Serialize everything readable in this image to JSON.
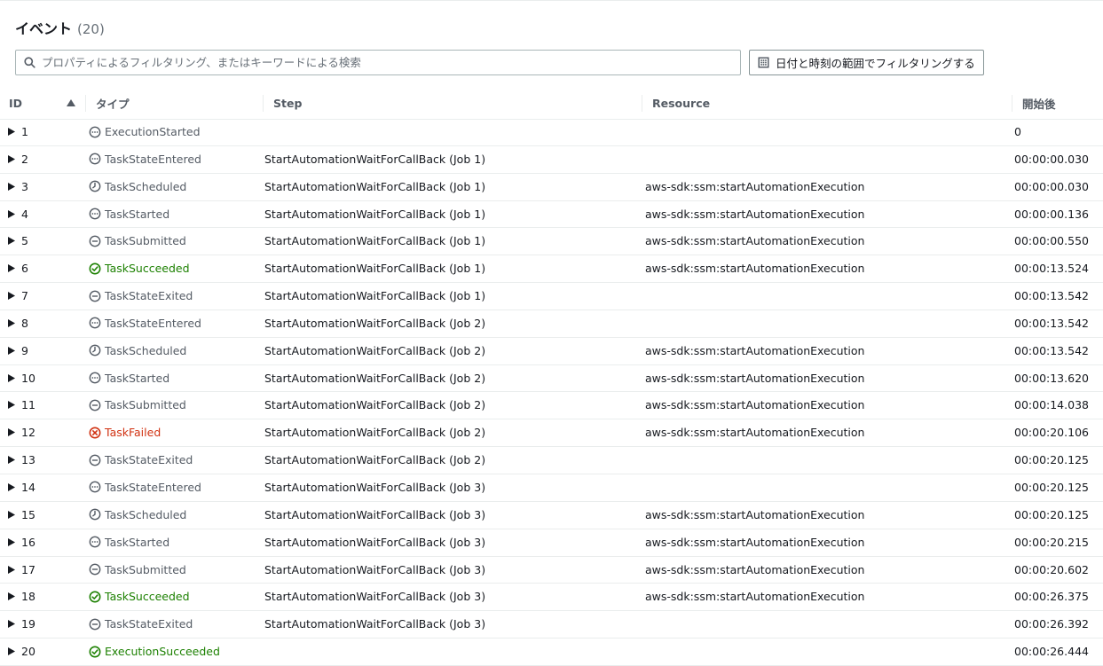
{
  "header": {
    "title": "イベント",
    "count": "(20)"
  },
  "search": {
    "placeholder": "プロパティによるフィルタリング、またはキーワードによる検索"
  },
  "date_filter": {
    "label": "日付と時刻の範囲でフィルタリングする"
  },
  "columns": {
    "id": "ID",
    "type": "タイプ",
    "step": "Step",
    "resource": "Resource",
    "elapsed": "開始後"
  },
  "colors": {
    "success": "#1d8102",
    "error": "#d13212",
    "neutral": "#545b64"
  },
  "rows": [
    {
      "id": "1",
      "type": "ExecutionStarted",
      "icon": "dots-circle-icon",
      "status": "neutral",
      "step": "",
      "resource": "",
      "elapsed": "0"
    },
    {
      "id": "2",
      "type": "TaskStateEntered",
      "icon": "dots-circle-icon",
      "status": "neutral",
      "step": "StartAutomationWaitForCallBack (Job 1)",
      "resource": "",
      "elapsed": "00:00:00.030"
    },
    {
      "id": "3",
      "type": "TaskScheduled",
      "icon": "clock-icon",
      "status": "neutral",
      "step": "StartAutomationWaitForCallBack (Job 1)",
      "resource": "aws-sdk:ssm:startAutomationExecution",
      "elapsed": "00:00:00.030"
    },
    {
      "id": "4",
      "type": "TaskStarted",
      "icon": "dots-circle-icon",
      "status": "neutral",
      "step": "StartAutomationWaitForCallBack (Job 1)",
      "resource": "aws-sdk:ssm:startAutomationExecution",
      "elapsed": "00:00:00.136"
    },
    {
      "id": "5",
      "type": "TaskSubmitted",
      "icon": "minus-circle-icon",
      "status": "neutral",
      "step": "StartAutomationWaitForCallBack (Job 1)",
      "resource": "aws-sdk:ssm:startAutomationExecution",
      "elapsed": "00:00:00.550"
    },
    {
      "id": "6",
      "type": "TaskSucceeded",
      "icon": "check-circle-icon",
      "status": "success",
      "step": "StartAutomationWaitForCallBack (Job 1)",
      "resource": "aws-sdk:ssm:startAutomationExecution",
      "elapsed": "00:00:13.524"
    },
    {
      "id": "7",
      "type": "TaskStateExited",
      "icon": "minus-circle-icon",
      "status": "neutral",
      "step": "StartAutomationWaitForCallBack (Job 1)",
      "resource": "",
      "elapsed": "00:00:13.542"
    },
    {
      "id": "8",
      "type": "TaskStateEntered",
      "icon": "dots-circle-icon",
      "status": "neutral",
      "step": "StartAutomationWaitForCallBack (Job 2)",
      "resource": "",
      "elapsed": "00:00:13.542"
    },
    {
      "id": "9",
      "type": "TaskScheduled",
      "icon": "clock-icon",
      "status": "neutral",
      "step": "StartAutomationWaitForCallBack (Job 2)",
      "resource": "aws-sdk:ssm:startAutomationExecution",
      "elapsed": "00:00:13.542"
    },
    {
      "id": "10",
      "type": "TaskStarted",
      "icon": "dots-circle-icon",
      "status": "neutral",
      "step": "StartAutomationWaitForCallBack (Job 2)",
      "resource": "aws-sdk:ssm:startAutomationExecution",
      "elapsed": "00:00:13.620"
    },
    {
      "id": "11",
      "type": "TaskSubmitted",
      "icon": "minus-circle-icon",
      "status": "neutral",
      "step": "StartAutomationWaitForCallBack (Job 2)",
      "resource": "aws-sdk:ssm:startAutomationExecution",
      "elapsed": "00:00:14.038"
    },
    {
      "id": "12",
      "type": "TaskFailed",
      "icon": "x-circle-icon",
      "status": "error",
      "step": "StartAutomationWaitForCallBack (Job 2)",
      "resource": "aws-sdk:ssm:startAutomationExecution",
      "elapsed": "00:00:20.106"
    },
    {
      "id": "13",
      "type": "TaskStateExited",
      "icon": "minus-circle-icon",
      "status": "neutral",
      "step": "StartAutomationWaitForCallBack (Job 2)",
      "resource": "",
      "elapsed": "00:00:20.125"
    },
    {
      "id": "14",
      "type": "TaskStateEntered",
      "icon": "dots-circle-icon",
      "status": "neutral",
      "step": "StartAutomationWaitForCallBack (Job 3)",
      "resource": "",
      "elapsed": "00:00:20.125"
    },
    {
      "id": "15",
      "type": "TaskScheduled",
      "icon": "clock-icon",
      "status": "neutral",
      "step": "StartAutomationWaitForCallBack (Job 3)",
      "resource": "aws-sdk:ssm:startAutomationExecution",
      "elapsed": "00:00:20.125"
    },
    {
      "id": "16",
      "type": "TaskStarted",
      "icon": "dots-circle-icon",
      "status": "neutral",
      "step": "StartAutomationWaitForCallBack (Job 3)",
      "resource": "aws-sdk:ssm:startAutomationExecution",
      "elapsed": "00:00:20.215"
    },
    {
      "id": "17",
      "type": "TaskSubmitted",
      "icon": "minus-circle-icon",
      "status": "neutral",
      "step": "StartAutomationWaitForCallBack (Job 3)",
      "resource": "aws-sdk:ssm:startAutomationExecution",
      "elapsed": "00:00:20.602"
    },
    {
      "id": "18",
      "type": "TaskSucceeded",
      "icon": "check-circle-icon",
      "status": "success",
      "step": "StartAutomationWaitForCallBack (Job 3)",
      "resource": "aws-sdk:ssm:startAutomationExecution",
      "elapsed": "00:00:26.375"
    },
    {
      "id": "19",
      "type": "TaskStateExited",
      "icon": "minus-circle-icon",
      "status": "neutral",
      "step": "StartAutomationWaitForCallBack (Job 3)",
      "resource": "",
      "elapsed": "00:00:26.392"
    },
    {
      "id": "20",
      "type": "ExecutionSucceeded",
      "icon": "check-circle-icon",
      "status": "success",
      "step": "",
      "resource": "",
      "elapsed": "00:00:26.444"
    }
  ]
}
